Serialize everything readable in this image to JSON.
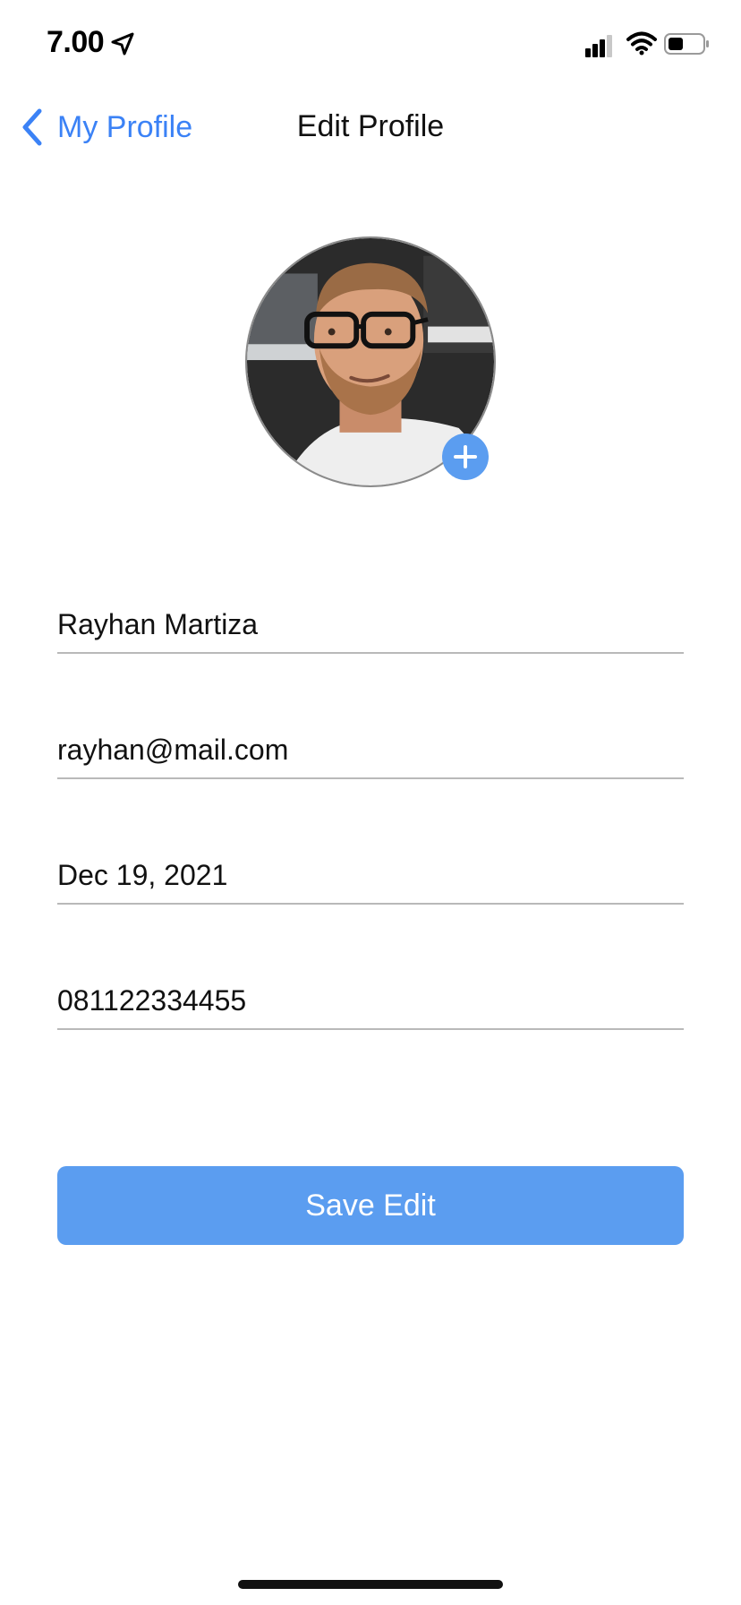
{
  "status_bar": {
    "time": "7.00",
    "icons": [
      "location-arrow-icon",
      "cellular-signal-icon",
      "wifi-icon",
      "battery-icon"
    ]
  },
  "nav": {
    "back_label": "My Profile",
    "title": "Edit Profile"
  },
  "avatar": {
    "add_icon": "plus-icon"
  },
  "form": {
    "name": "Rayhan Martiza",
    "email": "rayhan@mail.com",
    "birthdate": "Dec 19, 2021",
    "phone": "081122334455"
  },
  "actions": {
    "save_label": "Save Edit"
  },
  "colors": {
    "accent": "#3b82f6",
    "button": "#5b9df0",
    "divider": "#b9b9b9"
  }
}
